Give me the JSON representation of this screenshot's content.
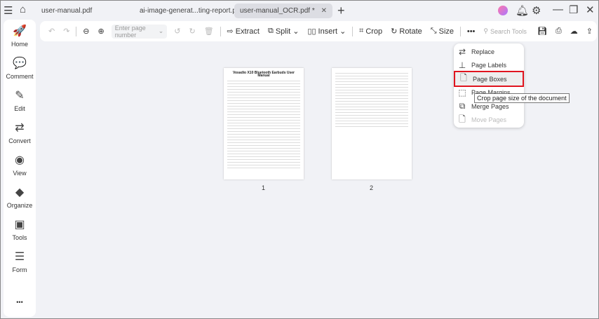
{
  "tabs": [
    {
      "label": "user-manual.pdf"
    },
    {
      "label": "ai-image-generat...ting-report.pdf *"
    },
    {
      "label": "user-manual_OCR.pdf *",
      "active": true
    }
  ],
  "sidebar": {
    "items": [
      {
        "label": "Home",
        "icon": "rocket-icon",
        "glyph": "🚀"
      },
      {
        "label": "Comment",
        "icon": "comment-icon",
        "glyph": "💬"
      },
      {
        "label": "Edit",
        "icon": "edit-icon",
        "glyph": "✎"
      },
      {
        "label": "Convert",
        "icon": "convert-icon",
        "glyph": "⇄"
      },
      {
        "label": "View",
        "icon": "view-icon",
        "glyph": "◉"
      },
      {
        "label": "Organize",
        "icon": "organize-icon",
        "glyph": "◆"
      },
      {
        "label": "Tools",
        "icon": "tools-icon",
        "glyph": "▣"
      },
      {
        "label": "Form",
        "icon": "form-icon",
        "glyph": "☰"
      }
    ],
    "more": "•••"
  },
  "toolbar": {
    "page_placeholder": "Enter page number",
    "extract": "Extract",
    "split": "Split",
    "insert": "Insert",
    "crop": "Crop",
    "rotate": "Rotate",
    "size": "Size",
    "more": "•••",
    "search_placeholder": "Search Tools"
  },
  "menu": {
    "items": [
      {
        "label": "Replace",
        "glyph": "⇄"
      },
      {
        "label": "Page Labels",
        "glyph": "⊥"
      },
      {
        "label": "Page Boxes",
        "glyph": "🗋",
        "highlight": true
      },
      {
        "label": "Page Margins",
        "glyph": "⬚"
      },
      {
        "label": "Merge Pages",
        "glyph": "⧉"
      },
      {
        "label": "Move Pages",
        "glyph": "🗋",
        "disabled": true
      }
    ]
  },
  "tooltip": "Crop page size of the document",
  "pages": [
    {
      "number": "1",
      "title": "Vosadio X10 Bluetooth Earbuds User Manual"
    },
    {
      "number": "2"
    }
  ],
  "colors": {
    "highlight": "#e0141e"
  }
}
